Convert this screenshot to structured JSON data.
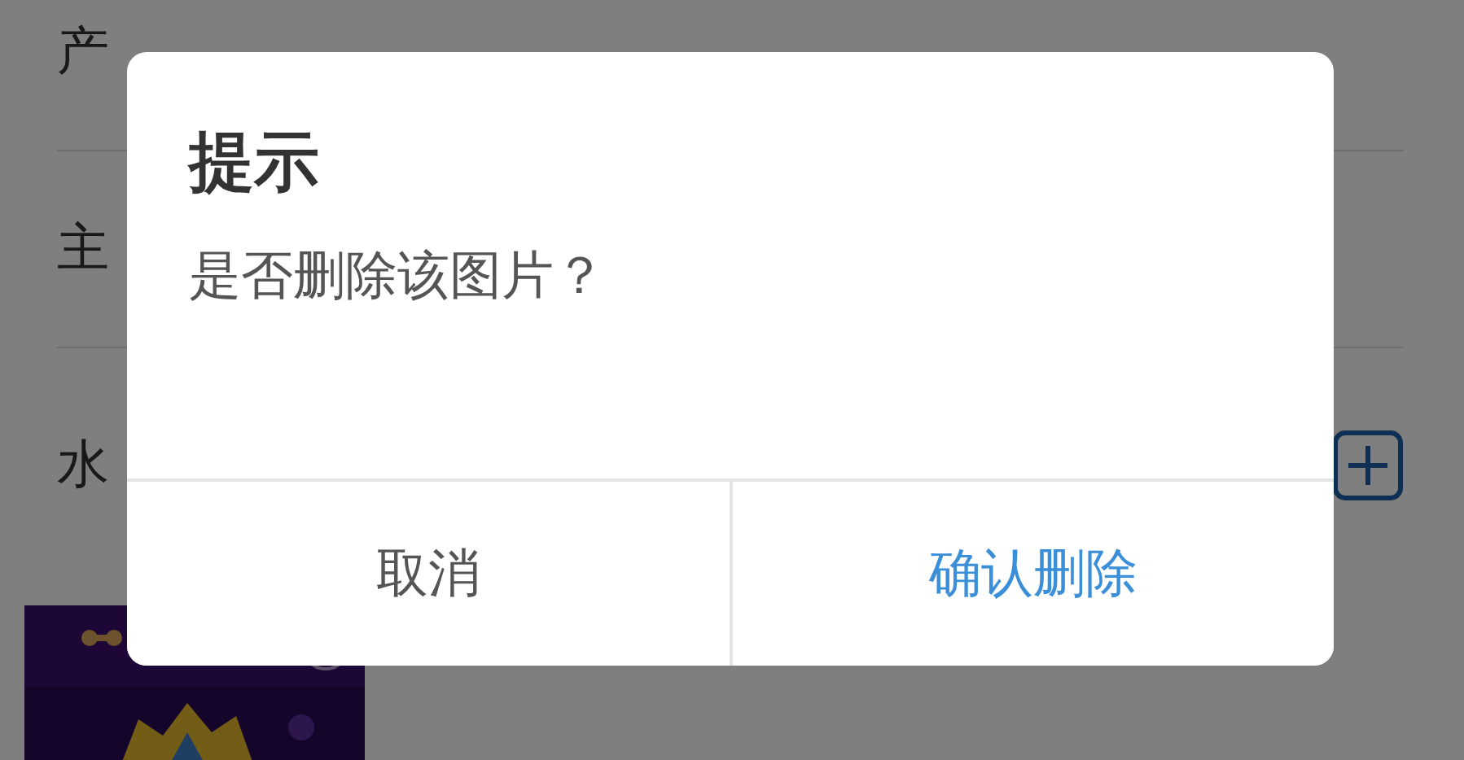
{
  "form": {
    "rows": [
      {
        "label": "产",
        "kind": "text"
      },
      {
        "label": "主",
        "kind": "text"
      },
      {
        "label": "水",
        "kind": "add"
      }
    ]
  },
  "dialog": {
    "title": "提示",
    "message": "是否删除该图片？",
    "buttons": [
      {
        "label": "取消",
        "kind": "cancel"
      },
      {
        "label": "确认删除",
        "kind": "confirm"
      }
    ]
  }
}
